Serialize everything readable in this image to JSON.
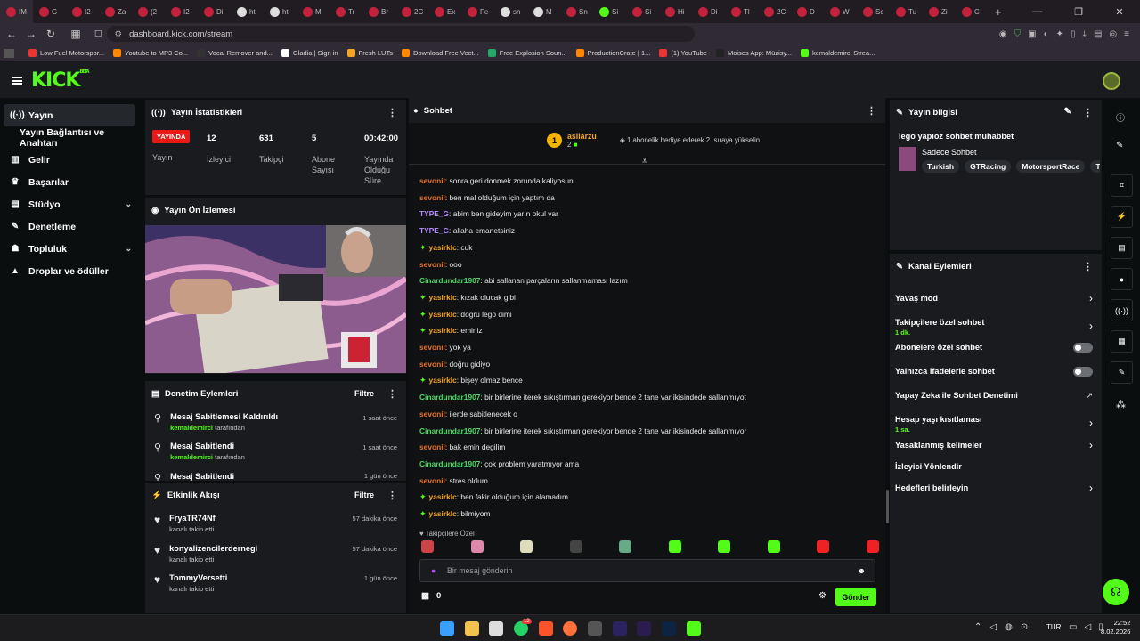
{
  "browser": {
    "tabs": [
      "IM",
      "G",
      "I2",
      "Za",
      "(2",
      "I2",
      "Di",
      "ht",
      "ht",
      "M",
      "Tr",
      "Br",
      "2C",
      "Ex",
      "Fe",
      "sn",
      "M",
      "Sn",
      "Si",
      "Si",
      "Hi",
      "Di",
      "Tl",
      "2C",
      "D",
      "W",
      "Sc",
      "Tu",
      "Zi",
      "C"
    ],
    "new_tab": "+",
    "url": "dashboard.kick.com/stream",
    "bookmarks": [
      "Low Fuel Motorspor...",
      "Youtube to MP3 Co...",
      "Vocal Remover and...",
      "Gladia | Sign in",
      "Fresh LUTs",
      "Download Free Vect...",
      "Free Explosion Soun...",
      "ProductionCrate | 1...",
      "(1) YouTube",
      "Moises App: Müzisy...",
      "kemaldemirci Strea..."
    ]
  },
  "header": {
    "logo": "KICK",
    "logo_badge": "BETA"
  },
  "sidebar": {
    "items": [
      {
        "label": "Yayın",
        "icon": "broadcast-icon"
      },
      {
        "label": "Yayın Bağlantısı ve Anahtarı"
      },
      {
        "label": "Gelir",
        "icon": "chart-icon"
      },
      {
        "label": "Başarılar",
        "icon": "trophy-icon"
      },
      {
        "label": "Stüdyo",
        "icon": "studio-icon"
      },
      {
        "label": "Denetleme",
        "icon": "wrench-icon"
      },
      {
        "label": "Topluluk",
        "icon": "community-icon"
      },
      {
        "label": "Droplar ve ödüller",
        "icon": "drops-icon"
      }
    ]
  },
  "stats": {
    "title": "Yayın İstatistikleri",
    "live_badge": "YAYINDA",
    "live_label": "Yayın",
    "viewers": "12",
    "viewers_label": "İzleyici",
    "followers": "631",
    "followers_label": "Takipçi",
    "subs": "5",
    "subs_label": "Abone Sayısı",
    "duration": "00:42:00",
    "duration_label": "Yayında Olduğu Süre"
  },
  "preview": {
    "title": "Yayın Ön İzlemesi"
  },
  "moderation": {
    "title": "Denetim Eylemleri",
    "filter": "Filtre",
    "items": [
      {
        "title": "Mesaj Sabitlemesi Kaldırıldı",
        "user": "kemaldemirci",
        "suffix": "tarafından",
        "time": "1 saat önce"
      },
      {
        "title": "Mesaj Sabitlendi",
        "user": "kemaldemirci",
        "suffix": "tarafından",
        "time": "1 saat önce"
      },
      {
        "title": "Mesaj Sabitlendi",
        "user": "",
        "suffix": "",
        "time": "1 gün önce"
      }
    ]
  },
  "activity": {
    "title": "Etkinlik Akışı",
    "filter": "Filtre",
    "items": [
      {
        "name": "FryaTR74Nf",
        "action": "kanalı takip etti",
        "time": "57 dakika önce"
      },
      {
        "name": "konyalizencilerdernegi",
        "action": "kanalı takip etti",
        "time": "57 dakika önce"
      },
      {
        "name": "TommyVersetti",
        "action": "kanalı takip etti",
        "time": "1 gün önce"
      }
    ]
  },
  "chat": {
    "title": "Sohbet",
    "pinned_user": "asliarzu",
    "pinned_rank": "1",
    "pinned_count": "2",
    "pinned_note": "1 abonelik hediye ederek 2. sıraya yükselin",
    "messages": [
      {
        "user": "sevonil",
        "color": "#e8712c",
        "text": "sonra geri donmek zorunda kaliyosun",
        "badge": false
      },
      {
        "user": "sevonil",
        "color": "#e8712c",
        "text": "ben mal olduğum için yaptım da",
        "badge": false
      },
      {
        "user": "TYPE_G",
        "color": "#b58cff",
        "text": "abim ben gideyim yarın okul var",
        "badge": false
      },
      {
        "user": "TYPE_G",
        "color": "#b58cff",
        "text": "allaha emanetsiniz",
        "badge": false
      },
      {
        "user": "yasirklc",
        "color": "#f5a524",
        "text": "cuk",
        "badge": true
      },
      {
        "user": "sevonil",
        "color": "#e8712c",
        "text": "ooo",
        "badge": false
      },
      {
        "user": "Cinardundar1907",
        "color": "#4cd964",
        "text": "abi sallanan parçaların sallanmaması lazım",
        "badge": false
      },
      {
        "user": "yasirklc",
        "color": "#f5a524",
        "text": "kızak olucak gibi",
        "badge": true
      },
      {
        "user": "yasirklc",
        "color": "#f5a524",
        "text": "doğru lego dimi",
        "badge": true
      },
      {
        "user": "yasirklc",
        "color": "#f5a524",
        "text": "eminiz",
        "badge": true
      },
      {
        "user": "sevonil",
        "color": "#e8712c",
        "text": "yok ya",
        "badge": false
      },
      {
        "user": "sevonil",
        "color": "#e8712c",
        "text": "doğru gidiyo",
        "badge": false
      },
      {
        "user": "yasirklc",
        "color": "#f5a524",
        "text": "bişey olmaz bence",
        "badge": true
      },
      {
        "user": "Cinardundar1907",
        "color": "#4cd964",
        "text": "bir birlerine iterek sıkıştırman gerekiyor bende 2 tane var ikisindede sallanmıyot",
        "badge": false
      },
      {
        "user": "sevonil",
        "color": "#e8712c",
        "text": "ilerde sabitlenecek o",
        "badge": false
      },
      {
        "user": "Cinardundar1907",
        "color": "#4cd964",
        "text": "bir birlerine iterek sıkıştırman gerekiyor bende 2 tane var ikisindede sallanmıyor",
        "badge": false
      },
      {
        "user": "sevonil",
        "color": "#e8712c",
        "text": "bak emin degilim",
        "badge": false
      },
      {
        "user": "Cinardundar1907",
        "color": "#4cd964",
        "text": "çok problem yaratmıyor ama",
        "badge": false
      },
      {
        "user": "sevonil",
        "color": "#e8712c",
        "text": "stres oldum",
        "badge": false
      },
      {
        "user": "yasirklc",
        "color": "#f5a524",
        "text": "ben fakir olduğum için alamadım",
        "badge": true
      },
      {
        "user": "yasirklc",
        "color": "#f5a524",
        "text": "bilmiyom",
        "badge": true
      }
    ],
    "emote_section": "Takipçilere Özel",
    "input_placeholder": "Bir mesaj gönderin",
    "points": "0",
    "send": "Gönder"
  },
  "stream_info": {
    "title": "Yayın bilgisi",
    "stream_title": "lego yapıoz sohbet muhabbet",
    "category": "Sadece Sohbet",
    "tags": [
      "Turkish",
      "GTRacing",
      "MotorsportRace",
      "T"
    ]
  },
  "channel_actions": {
    "title": "Kanal Eylemleri",
    "items": [
      {
        "label": "Yavaş mod",
        "sub": "",
        "control": "chevron"
      },
      {
        "label": "Takipçilere özel sohbet",
        "sub": "1 dk.",
        "control": "chevron"
      },
      {
        "label": "Abonelere özel sohbet",
        "sub": "",
        "control": "toggle"
      },
      {
        "label": "Yalnızca ifadelerle sohbet",
        "sub": "",
        "control": "toggle"
      },
      {
        "label": "Yapay Zeka ile Sohbet Denetimi",
        "sub": "",
        "control": "external"
      },
      {
        "label": "Hesap yaşı kısıtlaması",
        "sub": "1 sa.",
        "control": "chevron"
      },
      {
        "label": "Yasaklanmış kelimeler",
        "sub": "",
        "control": "chevron"
      },
      {
        "label": "İzleyici Yönlendir",
        "sub": "",
        "control": "none"
      },
      {
        "label": "Hedefleri belirleyin",
        "sub": "",
        "control": "chevron"
      }
    ]
  },
  "taskbar": {
    "lang": "TUR",
    "time": "22:52",
    "date": "8.02.2026",
    "whatsapp_badge": "12"
  },
  "colors": {
    "accent": "#53fc18",
    "live": "#e91916"
  }
}
